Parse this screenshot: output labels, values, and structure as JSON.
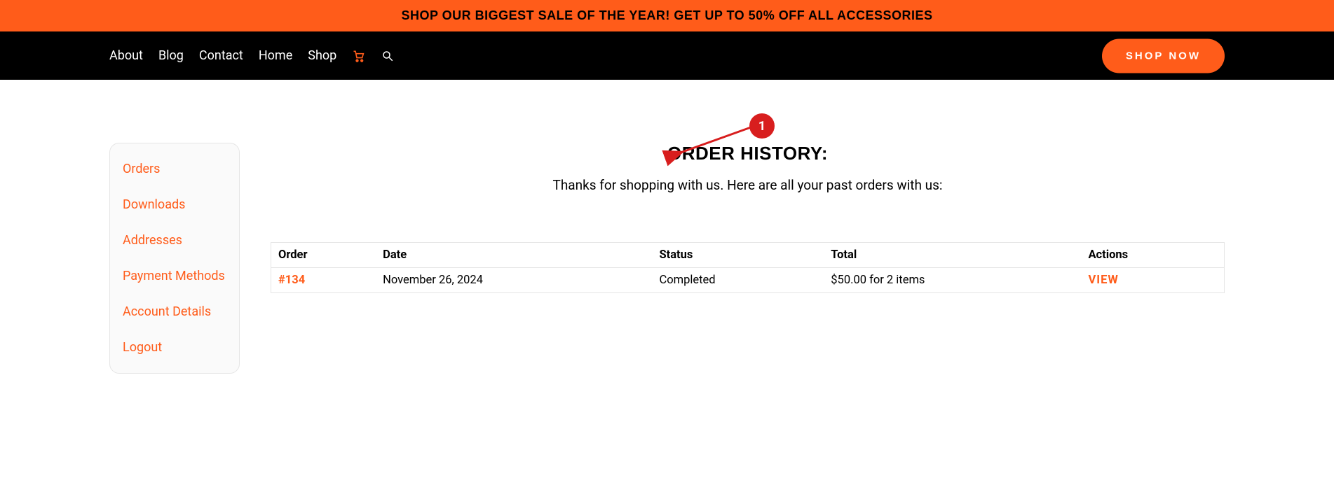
{
  "promo": "SHOP OUR BIGGEST SALE OF THE YEAR! GET UP TO 50% OFF ALL ACCESSORIES",
  "nav": {
    "items": [
      "About",
      "Blog",
      "Contact",
      "Home",
      "Shop"
    ],
    "shop_now": "SHOP NOW"
  },
  "sidebar": {
    "items": [
      "Orders",
      "Downloads",
      "Addresses",
      "Payment Methods",
      "Account Details",
      "Logout"
    ]
  },
  "main": {
    "title": "ORDER HISTORY:",
    "subtitle": "Thanks for shopping with us. Here are all your past orders with us:"
  },
  "orders_table": {
    "headers": [
      "Order",
      "Date",
      "Status",
      "Total",
      "Actions"
    ],
    "rows": [
      {
        "order": "#134",
        "date": "November 26, 2024",
        "status": "Completed",
        "total": "$50.00 for 2 items",
        "action": "VIEW"
      }
    ]
  },
  "annotation": {
    "badge": "1"
  }
}
